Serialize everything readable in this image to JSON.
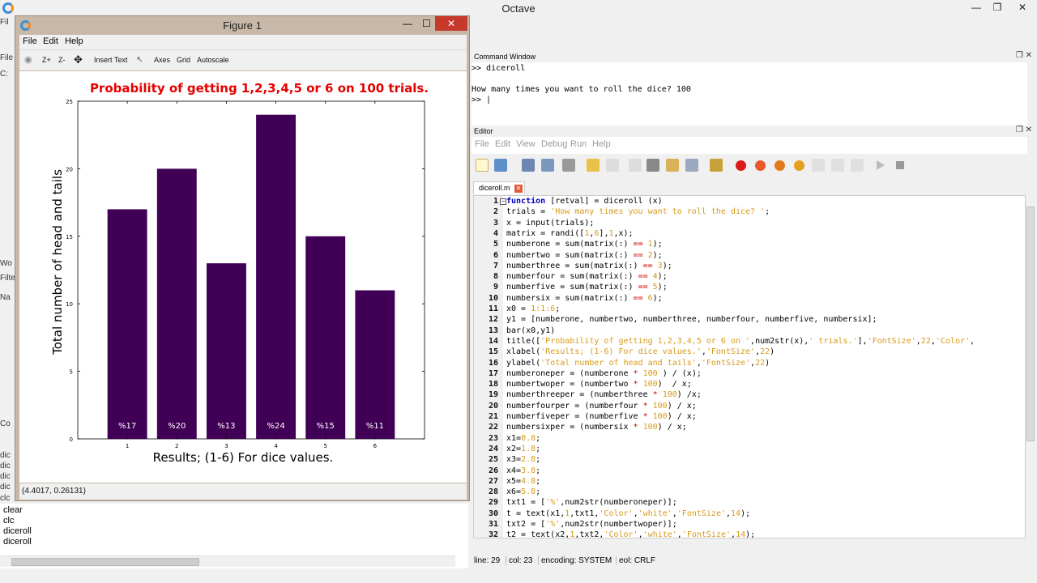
{
  "app": {
    "title": "Octave",
    "left_labels": [
      "Fil",
      "File",
      "C:",
      "Wo",
      "Filte",
      "Na",
      "Co"
    ],
    "history": [
      "dic",
      "dic",
      "dic",
      "dic",
      "clc",
      "clear",
      "clc",
      "diceroll",
      "diceroll"
    ]
  },
  "figure": {
    "title": "Figure 1",
    "menu": [
      "File",
      "Edit",
      "Help"
    ],
    "toolbar": [
      "Z+",
      "Z-",
      "Insert Text",
      "Axes",
      "Grid",
      "Autoscale"
    ],
    "status": "(4.4017, 0.26131)"
  },
  "chart_data": {
    "type": "bar",
    "title": "Probability of getting 1,2,3,4,5 or 6 on 100 trials.",
    "xlabel": "Results; (1-6) For dice values.",
    "ylabel": "Total number of head and tails",
    "categories": [
      "1",
      "2",
      "3",
      "4",
      "5",
      "6"
    ],
    "values": [
      17,
      20,
      13,
      24,
      15,
      11
    ],
    "bar_labels": [
      "%17",
      "%20",
      "%13",
      "%24",
      "%15",
      "%11"
    ],
    "ylim": [
      0,
      25
    ],
    "yticks": [
      0,
      5,
      10,
      15,
      20,
      25
    ],
    "bar_color": "#400055",
    "title_color": "#e60000",
    "grid": false
  },
  "command_window": {
    "title": "Command Window",
    "lines": [
      ">> diceroll",
      "",
      "How many times you want to roll the dice? 100",
      ">> |"
    ]
  },
  "editor": {
    "title": "Editor",
    "menu": [
      "File",
      "Edit",
      "View",
      "Debug",
      "Run",
      "Help"
    ],
    "tab": "diceroll.m",
    "code": [
      [
        [
          "kw",
          "function"
        ],
        [
          "t",
          " [retval] = diceroll (x)"
        ]
      ],
      [
        [
          "t",
          "trials = "
        ],
        [
          "str",
          "'How many times you want to roll the dice? '"
        ],
        [
          "t",
          ";"
        ]
      ],
      [
        [
          "t",
          "x = input(trials);"
        ]
      ],
      [
        [
          "t",
          "matrix = randi(["
        ],
        [
          "num",
          "1"
        ],
        [
          "t",
          ","
        ],
        [
          "num",
          "6"
        ],
        [
          "t",
          "],"
        ],
        [
          "num",
          "1"
        ],
        [
          "t",
          ",x);"
        ]
      ],
      [
        [
          "t",
          "numberone = sum(matrix(:) "
        ],
        [
          "op",
          "=="
        ],
        [
          "t",
          " "
        ],
        [
          "num",
          "1"
        ],
        [
          "t",
          ");"
        ]
      ],
      [
        [
          "t",
          "numbertwo = sum(matrix(:) "
        ],
        [
          "op",
          "=="
        ],
        [
          "t",
          " "
        ],
        [
          "num",
          "2"
        ],
        [
          "t",
          ");"
        ]
      ],
      [
        [
          "t",
          "numberthree = sum(matrix(:) "
        ],
        [
          "op",
          "=="
        ],
        [
          "t",
          " "
        ],
        [
          "num",
          "3"
        ],
        [
          "t",
          ");"
        ]
      ],
      [
        [
          "t",
          "numberfour = sum(matrix(:) "
        ],
        [
          "op",
          "=="
        ],
        [
          "t",
          " "
        ],
        [
          "num",
          "4"
        ],
        [
          "t",
          ");"
        ]
      ],
      [
        [
          "t",
          "numberfive = sum(matrix(:) "
        ],
        [
          "op",
          "=="
        ],
        [
          "t",
          " "
        ],
        [
          "num",
          "5"
        ],
        [
          "t",
          ");"
        ]
      ],
      [
        [
          "t",
          "numbersix = sum(matrix(:) "
        ],
        [
          "op",
          "=="
        ],
        [
          "t",
          " "
        ],
        [
          "num",
          "6"
        ],
        [
          "t",
          ");"
        ]
      ],
      [
        [
          "t",
          "x0 = "
        ],
        [
          "num",
          "1:1:6"
        ],
        [
          "t",
          ";"
        ]
      ],
      [
        [
          "t",
          "y1 = [numberone, numbertwo, numberthree, numberfour, numberfive, numbersix];"
        ]
      ],
      [
        [
          "t",
          "bar(x0,y1)"
        ]
      ],
      [
        [
          "t",
          "title(["
        ],
        [
          "str",
          "'Probability of getting 1,2,3,4,5 or 6 on '"
        ],
        [
          "t",
          ",num2str(x),"
        ],
        [
          "str",
          "' trials.'"
        ],
        [
          "t",
          "],"
        ],
        [
          "str",
          "'FontSize'"
        ],
        [
          "t",
          ","
        ],
        [
          "num",
          "22"
        ],
        [
          "t",
          ","
        ],
        [
          "str",
          "'Color'"
        ],
        [
          "t",
          ","
        ]
      ],
      [
        [
          "t",
          "xlabel("
        ],
        [
          "str",
          "'Results; (1-6) For dice values.'"
        ],
        [
          "t",
          ","
        ],
        [
          "str",
          "'FontSize'"
        ],
        [
          "t",
          ","
        ],
        [
          "num",
          "22"
        ],
        [
          "t",
          ")"
        ]
      ],
      [
        [
          "t",
          "ylabel("
        ],
        [
          "str",
          "'Total number of head and tails'"
        ],
        [
          "t",
          ","
        ],
        [
          "str",
          "'FontSize'"
        ],
        [
          "t",
          ","
        ],
        [
          "num",
          "22"
        ],
        [
          "t",
          ")"
        ]
      ],
      [
        [
          "t",
          "numberoneper = (numberone "
        ],
        [
          "op",
          "*"
        ],
        [
          "t",
          " "
        ],
        [
          "num",
          "100"
        ],
        [
          "t",
          " ) / (x);"
        ]
      ],
      [
        [
          "t",
          "numbertwoper = (numbertwo "
        ],
        [
          "op",
          "*"
        ],
        [
          "t",
          " "
        ],
        [
          "num",
          "100"
        ],
        [
          "t",
          ")  / x;"
        ]
      ],
      [
        [
          "t",
          "numberthreeper = (numberthree "
        ],
        [
          "op",
          "*"
        ],
        [
          "t",
          " "
        ],
        [
          "num",
          "100"
        ],
        [
          "t",
          ") /x;"
        ]
      ],
      [
        [
          "t",
          "numberfourper = (numberfour "
        ],
        [
          "op",
          "*"
        ],
        [
          "t",
          " "
        ],
        [
          "num",
          "100"
        ],
        [
          "t",
          ") / x;"
        ]
      ],
      [
        [
          "t",
          "numberfiveper = (numberfive "
        ],
        [
          "op",
          "*"
        ],
        [
          "t",
          " "
        ],
        [
          "num",
          "100"
        ],
        [
          "t",
          ") / x;"
        ]
      ],
      [
        [
          "t",
          "numbersixper = (numbersix "
        ],
        [
          "op",
          "*"
        ],
        [
          "t",
          " "
        ],
        [
          "num",
          "100"
        ],
        [
          "t",
          ") / x;"
        ]
      ],
      [
        [
          "t",
          "x1="
        ],
        [
          "num",
          "0.8"
        ],
        [
          "t",
          ";"
        ]
      ],
      [
        [
          "t",
          "x2="
        ],
        [
          "num",
          "1.8"
        ],
        [
          "t",
          ";"
        ]
      ],
      [
        [
          "t",
          "x3="
        ],
        [
          "num",
          "2.8"
        ],
        [
          "t",
          ";"
        ]
      ],
      [
        [
          "t",
          "x4="
        ],
        [
          "num",
          "3.8"
        ],
        [
          "t",
          ";"
        ]
      ],
      [
        [
          "t",
          "x5="
        ],
        [
          "num",
          "4.8"
        ],
        [
          "t",
          ";"
        ]
      ],
      [
        [
          "t",
          "x6="
        ],
        [
          "num",
          "5.8"
        ],
        [
          "t",
          ";"
        ]
      ],
      [
        [
          "t",
          "txt1 = ["
        ],
        [
          "str",
          "'%'"
        ],
        [
          "t",
          ",num2str(numberoneper)];"
        ]
      ],
      [
        [
          "t",
          "t = text(x1,"
        ],
        [
          "num",
          "1"
        ],
        [
          "t",
          ",txt1,"
        ],
        [
          "str",
          "'Color'"
        ],
        [
          "t",
          ","
        ],
        [
          "str",
          "'white'"
        ],
        [
          "t",
          ","
        ],
        [
          "str",
          "'FontSize'"
        ],
        [
          "t",
          ","
        ],
        [
          "num",
          "14"
        ],
        [
          "t",
          ");"
        ]
      ],
      [
        [
          "t",
          "txt2 = ["
        ],
        [
          "str",
          "'%'"
        ],
        [
          "t",
          ",num2str(numbertwoper)];"
        ]
      ],
      [
        [
          "t",
          "t2 = text(x2,"
        ],
        [
          "num",
          "1"
        ],
        [
          "t",
          ",txt2,"
        ],
        [
          "str",
          "'Color'"
        ],
        [
          "t",
          ","
        ],
        [
          "str",
          "'white'"
        ],
        [
          "t",
          ","
        ],
        [
          "str",
          "'FontSize'"
        ],
        [
          "t",
          ","
        ],
        [
          "num",
          "14"
        ],
        [
          "t",
          ");"
        ]
      ]
    ],
    "status": {
      "line": "line: 29",
      "col": "col: 23",
      "encoding": "encoding: SYSTEM",
      "eol": "eol: CRLF"
    }
  }
}
